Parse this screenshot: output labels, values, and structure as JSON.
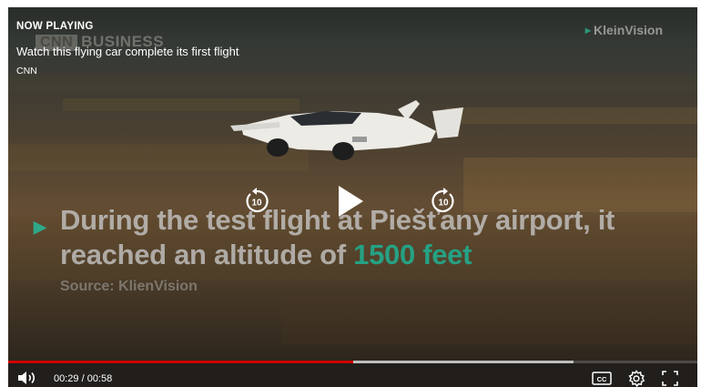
{
  "header": {
    "now_playing": "NOW PLAYING",
    "title": "Watch this flying car complete its first flight",
    "source": "CNN"
  },
  "video": {
    "ghost_logo_box": "CNN",
    "ghost_logo_text": "BUSINESS",
    "watermark": "KleinVision",
    "caption_line1": "During the test flight at Piešťany airport, it",
    "caption_line2_prefix": "reached an altitude of ",
    "caption_line2_highlight": "1500 feet",
    "caption_source": "Source: KlienVision",
    "skip_back_label": "10",
    "skip_forward_label": "10"
  },
  "controls": {
    "time_display": "00:29 / 00:58",
    "cc_label": "CC",
    "progress_fraction": 0.5,
    "buffered_fraction": 0.82
  },
  "colors": {
    "accent": "#cc0000",
    "caption_highlight": "#25a184"
  },
  "icons": [
    "volume-icon",
    "closed-captions-icon",
    "settings-gear-icon",
    "fullscreen-icon",
    "play-icon",
    "replay-10-icon",
    "forward-10-icon"
  ]
}
